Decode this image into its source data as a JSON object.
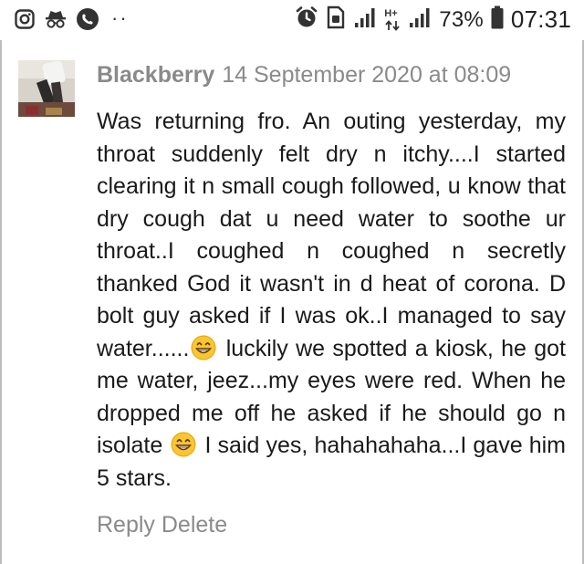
{
  "status_bar": {
    "battery_percent": "73%",
    "time": "07:31",
    "network_label": "H+",
    "left_icons": [
      "instagram-icon",
      "incognito-icon",
      "phone-icon"
    ],
    "right_icons": [
      "alarm-icon",
      "sim-icon",
      "signal-icon",
      "data-icon",
      "signal-icon",
      "battery-icon"
    ],
    "overflow_dots": "··"
  },
  "comment": {
    "author": "Blackberry",
    "timestamp": "14 September 2020 at 08:09",
    "segments": [
      "Was returning fro. An outing yesterday, my throat suddenly felt dry n itchy....I started clearing it n small cough followed, u know that dry cough dat u need water to soothe ur throat..I coughed n coughed n secretly thanked God it wasn't in d heat of corona. D bolt guy asked if I was ok..I managed to say water......",
      " luckily we spotted a kiosk, he got me water, jeez...my eyes were red. When he dropped me off he asked if he should go n isolate ",
      " I said yes, hahahahaha...I gave him 5 stars."
    ],
    "emoji_name": "grinning-face-icon",
    "reply_label": "Reply",
    "delete_label": "Delete"
  }
}
